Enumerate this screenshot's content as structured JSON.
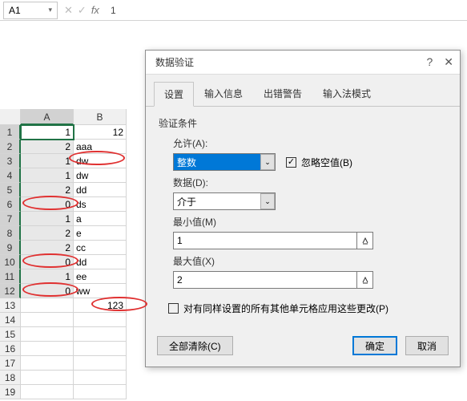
{
  "namebox": "A1",
  "formula_value": "1",
  "columns": [
    "A",
    "B"
  ],
  "rows": [
    {
      "n": 1,
      "a": "1",
      "b": "12"
    },
    {
      "n": 2,
      "a": "2",
      "b": "aaa"
    },
    {
      "n": 3,
      "a": "1",
      "b": "dw"
    },
    {
      "n": 4,
      "a": "1",
      "b": "dw"
    },
    {
      "n": 5,
      "a": "2",
      "b": "dd"
    },
    {
      "n": 6,
      "a": "0",
      "b": "ds"
    },
    {
      "n": 7,
      "a": "1",
      "b": "a"
    },
    {
      "n": 8,
      "a": "2",
      "b": "e"
    },
    {
      "n": 9,
      "a": "2",
      "b": "cc"
    },
    {
      "n": 10,
      "a": "0",
      "b": "dd"
    },
    {
      "n": 11,
      "a": "1",
      "b": "ee"
    },
    {
      "n": 12,
      "a": "0",
      "b": "ww"
    },
    {
      "n": 13,
      "a": "",
      "b": "123"
    },
    {
      "n": 14,
      "a": "",
      "b": ""
    },
    {
      "n": 15,
      "a": "",
      "b": ""
    },
    {
      "n": 16,
      "a": "",
      "b": ""
    },
    {
      "n": 17,
      "a": "",
      "b": ""
    },
    {
      "n": 18,
      "a": "",
      "b": ""
    },
    {
      "n": 19,
      "a": "",
      "b": ""
    }
  ],
  "dialog": {
    "title": "数据验证",
    "tabs": [
      "设置",
      "输入信息",
      "出错警告",
      "输入法模式"
    ],
    "criteria_title": "验证条件",
    "allow_label": "允许(A):",
    "allow_value": "整数",
    "ignore_blank": "忽略空值(B)",
    "data_label": "数据(D):",
    "data_value": "介于",
    "min_label": "最小值(M)",
    "min_value": "1",
    "max_label": "最大值(X)",
    "max_value": "2",
    "apply_all": "对有同样设置的所有其他单元格应用这些更改(P)",
    "clear_all": "全部清除(C)",
    "ok": "确定",
    "cancel": "取消"
  }
}
